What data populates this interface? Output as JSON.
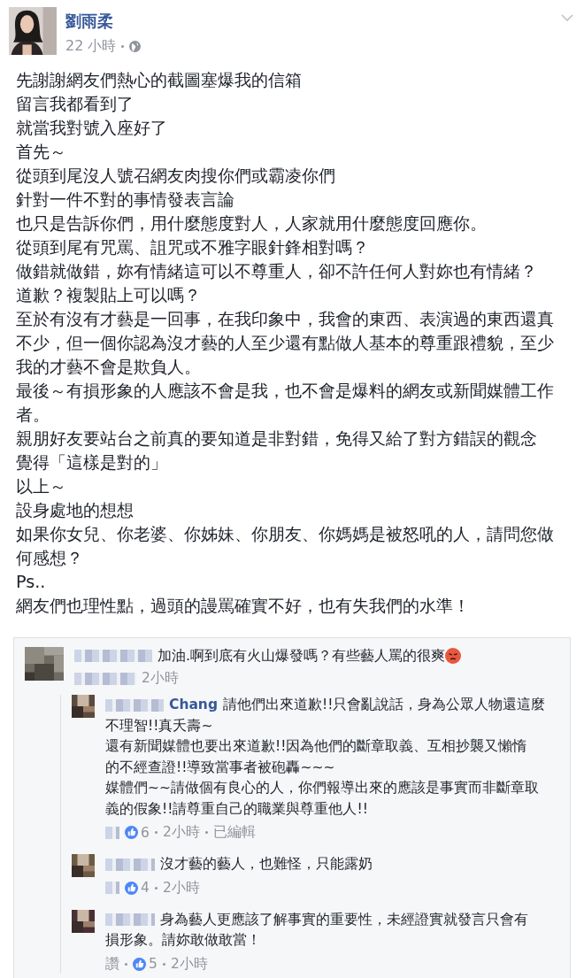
{
  "post": {
    "author": "劉雨柔",
    "time": "22 小時",
    "paragraphs": [
      "先謝謝網友們熱心的截圖塞爆我的信箱",
      "留言我都看到了",
      "就當我對號入座好了",
      "首先～",
      "從頭到尾沒人號召網友肉搜你們或霸凌你們",
      "針對一件不對的事情發表言論",
      "也只是告訴你們，用什麼態度對人，人家就用什麼態度回應你。",
      "從頭到尾有咒罵、詛咒或不雅字眼針鋒相對嗎？",
      "做錯就做錯，妳有情緒這可以不尊重人，卻不許任何人對妳也有情緒？",
      "道歉？複製貼上可以嗎？",
      "至於有沒有才藝是一回事，在我印象中，我會的東西、表演過的東西還真不少，但一個你認為沒才藝的人至少還有點做人基本的尊重跟禮貌，至少我的才藝不會是欺負人。",
      "最後～有損形象的人應該不會是我，也不會是爆料的網友或新聞媒體工作者。",
      "親朋好友要站台之前真的要知道是非對錯，免得又給了對方錯誤的觀念",
      "覺得「這樣是對的」",
      "以上～",
      "設身處地的想想",
      "如果你女兒、你老婆、你姊妹、你朋友、你媽媽是被怒吼的人，請問您做何感想？",
      "Ps..",
      "網友們也理性點，過頭的謾罵確實不好，也有失我們的水準！"
    ]
  },
  "comments": [
    {
      "lines": [
        "加油.啊到底有火山爆發嗎？有些藝人罵的很爽"
      ],
      "angry_emoji": true,
      "time": "2小時",
      "children": [
        {
          "name": "Chang",
          "lines": [
            "請他們出來道歉!!只會亂說話，身為公眾人物還這麼",
            "不理智!!真夭壽~",
            "還有新聞媒體也要出來道歉!!因為他們的斷章取義、互相抄襲又懶惰",
            "的不經查證!!導致當事者被砲轟~~~",
            "媒體們~~請做個有良心的人，你們報導出來的應該是事實而非斷章取",
            "義的假象!!請尊重自己的職業與尊重他人!!"
          ],
          "reactions": "6",
          "time": "2小時",
          "edited": "已編輯"
        },
        {
          "lines": [
            "沒才藝的藝人，也難怪，只能露奶"
          ],
          "reactions": "4",
          "time": "2小時"
        },
        {
          "lines": [
            "身為藝人更應該了解事實的重要性，未經證實就發言只會有",
            "損形象。請妳敢做敢當！"
          ],
          "like": "讚",
          "reactions": "5",
          "time": "2小時"
        }
      ]
    }
  ]
}
